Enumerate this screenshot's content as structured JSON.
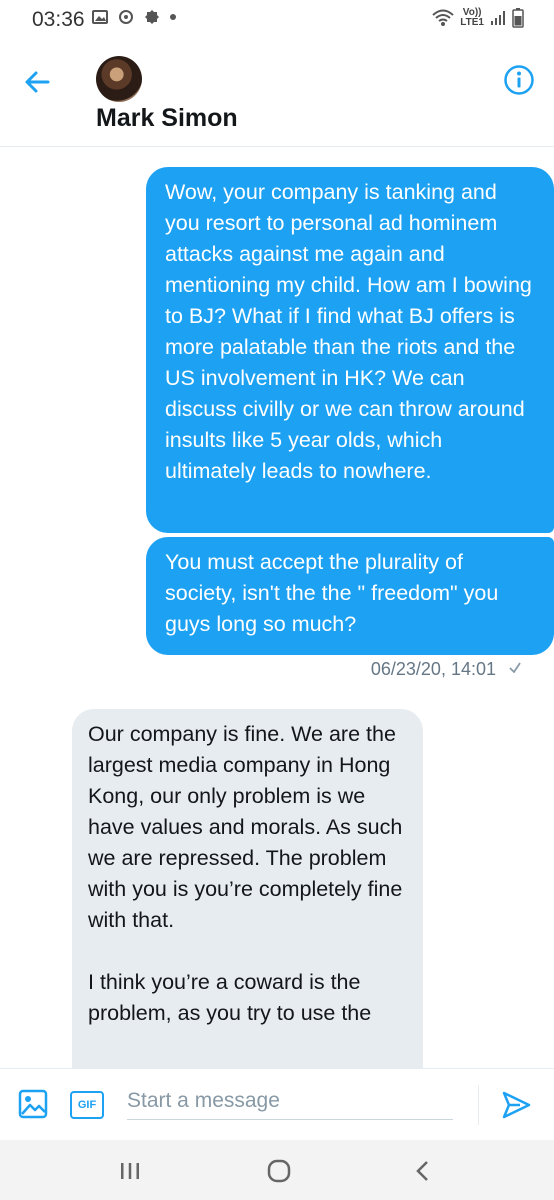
{
  "status_bar": {
    "time": "03:36",
    "network_line1": "Vo))",
    "network_line2": "LTE1"
  },
  "header": {
    "contact_name": "Mark Simon"
  },
  "messages": [
    {
      "direction": "sent",
      "text": "Wow, your company is tanking and you resort to personal ad hominem attacks against me again and mentioning my child. How am I bowing to BJ? What if I find what BJ offers is more palatable than the riots and the US involvement in HK? We can discuss civilly or we can throw around insults like 5 year olds, which ultimately leads to nowhere."
    },
    {
      "direction": "sent",
      "text": "You must accept the plurality of society, isn't the the \" freedom\" you guys long so much?"
    },
    {
      "direction": "received",
      "text": "Our company is fine.  We are the largest media company in Hong Kong, our only problem is we have values and morals.  As such we are repressed.  The problem with you is you’re completely fine with that.\n\nI think you’re a coward is the problem, as you try to use the"
    }
  ],
  "sent_timestamp": "06/23/20, 14:01",
  "composer": {
    "placeholder": "Start a message",
    "gif_label": "GIF"
  },
  "colors": {
    "accent": "#1da1f2",
    "received_bubble": "#e6ecf0"
  },
  "icons": [
    "back-arrow-icon",
    "info-icon",
    "image-icon",
    "gif-icon",
    "send-icon",
    "recent-apps-icon",
    "home-icon",
    "nav-back-icon"
  ]
}
